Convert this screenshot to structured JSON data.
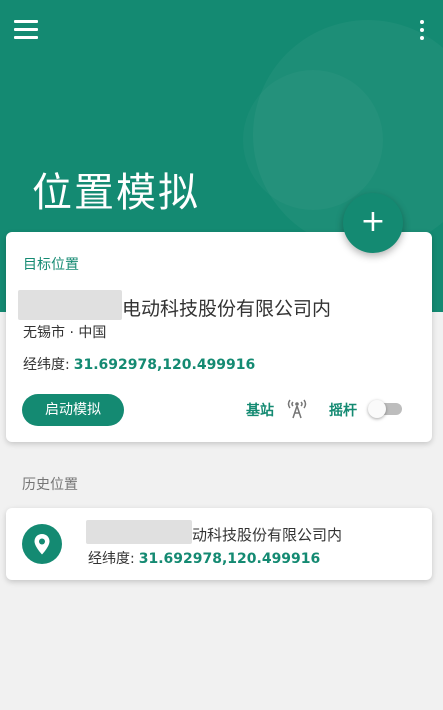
{
  "header": {
    "title": "位置模拟",
    "fab_label": "+"
  },
  "target": {
    "section_label": "目标位置",
    "place_name_visible": "电动科技股份有限公司内",
    "city": "无锡市 · 中国",
    "coords_label": "经纬度:",
    "coords_value": "31.692978,120.499916",
    "start_button": "启动模拟",
    "base_station_label": "基站",
    "joystick_label": "摇杆",
    "joystick_enabled": false
  },
  "history": {
    "section_label": "历史位置",
    "items": [
      {
        "name_visible": "动科技股份有限公司内",
        "coords_label": "经纬度:",
        "coords_value": "31.692978,120.499916"
      }
    ]
  },
  "colors": {
    "primary": "#148a72",
    "background": "#f1f1f1",
    "card": "#ffffff"
  }
}
